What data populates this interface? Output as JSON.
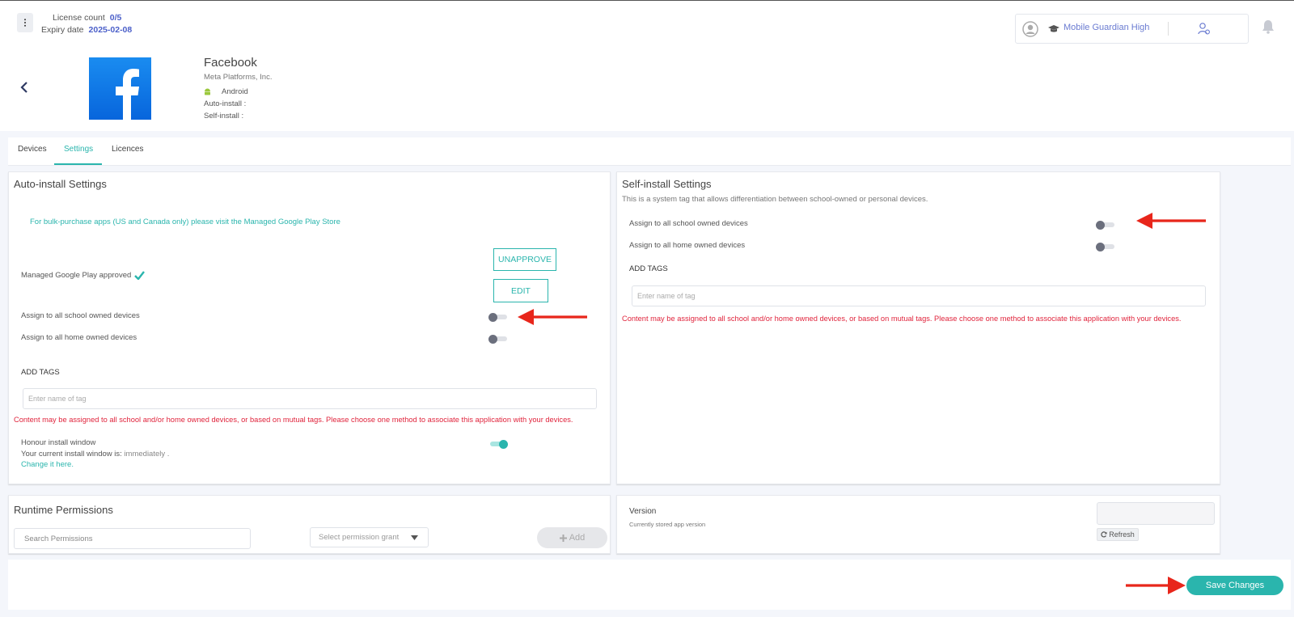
{
  "topbar": {
    "license_label": "License count",
    "license_value": "0/5",
    "expiry_label": "Expiry date",
    "expiry_value": "2025-02-08",
    "school_name": "Mobile Guardian High"
  },
  "app": {
    "name": "Facebook",
    "vendor": "Meta Platforms, Inc.",
    "platform": "Android",
    "auto_install_label": "Auto-install :",
    "self_install_label": "Self-install :"
  },
  "tabs": [
    {
      "label": "Devices",
      "active": false
    },
    {
      "label": "Settings",
      "active": true
    },
    {
      "label": "Licences",
      "active": false
    }
  ],
  "auto_install": {
    "title": "Auto-install Settings",
    "notice_text": "For bulk-purchase apps (US and Canada only) please visit the ",
    "notice_link": "Managed Google Play Store",
    "managed_label": "Managed Google Play approved",
    "unapprove_label": "UNAPPROVE",
    "edit_label": "EDIT",
    "school_label": "Assign to all school owned devices",
    "school_on": false,
    "home_label": "Assign to all home owned devices",
    "home_on": false,
    "tags_label": "ADD TAGS",
    "tag_placeholder": "Enter name of tag",
    "warning": "Content may be assigned to all school and/or home owned devices, or based on mutual tags. Please choose one method to associate this application with your devices.",
    "honour_label": "Honour install window",
    "honour_on": true,
    "window_text_prefix": "Your current install window is: ",
    "window_value": "immediately",
    "window_suffix": " .",
    "change_link": "Change it here."
  },
  "self_install": {
    "title": "Self-install Settings",
    "description": "This is a system tag that allows differentiation between school-owned or personal devices.",
    "school_label": "Assign to all school owned devices",
    "school_on": false,
    "home_label": "Assign to all home owned devices",
    "home_on": false,
    "tags_label": "ADD TAGS",
    "tag_placeholder": "Enter name of tag",
    "warning": "Content may be assigned to all school and/or home owned devices, or based on mutual tags. Please choose one method to associate this application with your devices."
  },
  "runtime": {
    "title": "Runtime Permissions",
    "search_placeholder": "Search Permissions",
    "select_placeholder": "Select permission grant",
    "add_label": "Add"
  },
  "version": {
    "label": "Version",
    "sublabel": "Currently stored app version",
    "refresh_label": "Refresh"
  },
  "footer": {
    "save_label": "Save Changes"
  },
  "colors": {
    "accent": "#2ab5ad",
    "link_blue": "#4b5fc9",
    "warning_red": "#e0243c",
    "annotation_arrow": "#e8261b"
  }
}
